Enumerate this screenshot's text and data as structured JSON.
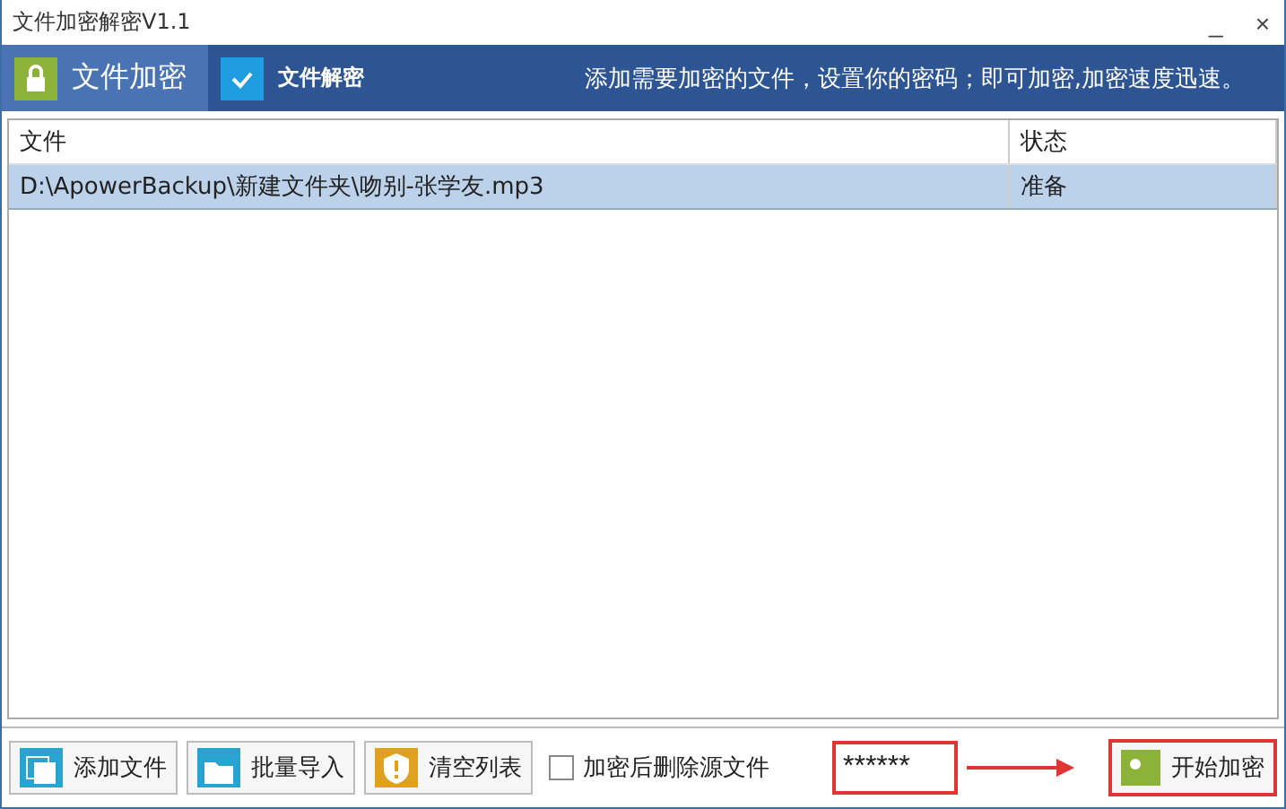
{
  "window": {
    "title": "文件加密解密V1.1",
    "controls": [
      "_",
      "×"
    ]
  },
  "tabs": [
    {
      "label": "文件加密",
      "selected": true,
      "kind": "lock"
    },
    {
      "label": "文件解密",
      "selected": false,
      "kind": "check"
    }
  ],
  "hint": "添加需要加密的文件，设置你的密码；即可加密,加密速度迅速。",
  "table": {
    "columns": [
      "文件",
      "状态"
    ],
    "rows": [
      {
        "cells": [
          "D:\\ApowerBackup\\新建文件夹\\吻别-张学友.mp3",
          "准备"
        ],
        "selected": true
      }
    ]
  },
  "toolbar": {
    "buttons": [
      {
        "label": "添加文件",
        "kind": "files"
      },
      {
        "label": "批量导入",
        "kind": "folder"
      },
      {
        "label": "清空列表",
        "kind": "warning"
      }
    ],
    "delete_source": {
      "label": "加密后删除源文件",
      "checked": false
    },
    "password": {
      "value": "******"
    },
    "start_button": {
      "label": "开始加密"
    }
  }
}
